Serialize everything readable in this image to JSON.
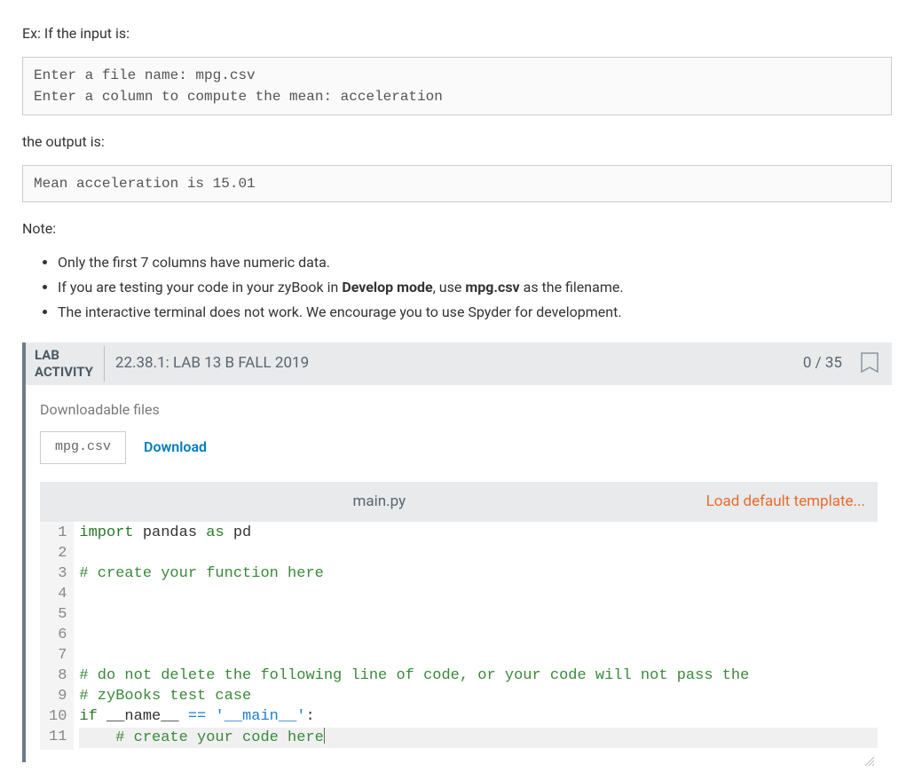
{
  "intro": {
    "ex_label": "Ex: If the input is:",
    "input_block": "Enter a file name: mpg.csv\nEnter a column to compute the mean: acceleration",
    "output_label": "the output is:",
    "output_block": "Mean acceleration is 15.01",
    "note_label": "Note:"
  },
  "notes": [
    {
      "pre": "Only the first 7 columns have numeric data."
    },
    {
      "pre": "If you are testing your code in your zyBook in ",
      "bold1": "Develop mode",
      "mid": ", use ",
      "bold2": "mpg.csv",
      "post": " as the filename."
    },
    {
      "pre": "The interactive terminal does not work. We encourage you to use Spyder for development."
    }
  ],
  "lab": {
    "activity_label_l1": "LAB",
    "activity_label_l2": "ACTIVITY",
    "title": "22.38.1: LAB 13 B FALL 2019",
    "score": "0 / 35",
    "downloadable_label": "Downloadable files",
    "file_chip": "mpg.csv",
    "download_link": "Download",
    "editor_filename": "main.py",
    "load_template": "Load default template..."
  },
  "code": {
    "lines": [
      {
        "n": 1,
        "tokens": [
          [
            "kw",
            "import"
          ],
          [
            "sp",
            " "
          ],
          [
            "mod",
            "pandas"
          ],
          [
            "sp",
            " "
          ],
          [
            "kw",
            "as"
          ],
          [
            "sp",
            " "
          ],
          [
            "mod",
            "pd"
          ]
        ]
      },
      {
        "n": 2,
        "tokens": []
      },
      {
        "n": 3,
        "tokens": [
          [
            "cmt",
            "# create your function here"
          ]
        ]
      },
      {
        "n": 4,
        "tokens": []
      },
      {
        "n": 5,
        "tokens": []
      },
      {
        "n": 6,
        "tokens": []
      },
      {
        "n": 7,
        "tokens": []
      },
      {
        "n": 8,
        "tokens": [
          [
            "cmt",
            "# do not delete the following line of code, or your code will not pass the"
          ]
        ]
      },
      {
        "n": 9,
        "tokens": [
          [
            "cmt",
            "# zyBooks test case"
          ]
        ]
      },
      {
        "n": 10,
        "tokens": [
          [
            "kw",
            "if"
          ],
          [
            "sp",
            " "
          ],
          [
            "id",
            "__name__"
          ],
          [
            "sp",
            " "
          ],
          [
            "eq",
            "=="
          ],
          [
            "sp",
            " "
          ],
          [
            "str",
            "'__main__'"
          ],
          [
            "pun",
            ":"
          ]
        ]
      },
      {
        "n": 11,
        "active": true,
        "tokens": [
          [
            "sp",
            "    "
          ],
          [
            "cmt",
            "# create your code here"
          ],
          [
            "cursor",
            ""
          ]
        ]
      }
    ]
  }
}
